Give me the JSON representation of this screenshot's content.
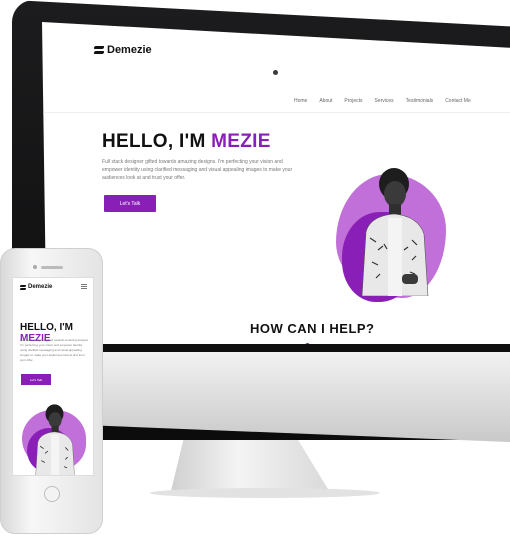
{
  "site": {
    "logo_text": "Demezie",
    "nav": [
      "Home",
      "About",
      "Projects",
      "Services",
      "Testimonials",
      "Contact Me"
    ],
    "hero_prefix": "HELLO, I'M ",
    "hero_name": "MEZIE",
    "hero_text": "Full stack designer gifted towards amazing designs. I'm perfecting your vision and empower identity using clarified messaging and visual appealing images to make your audiences look at and trust your offer.",
    "cta_label": "Let's Talk",
    "section_title": "HOW CAN I HELP?"
  },
  "colors": {
    "accent": "#8a1fb8",
    "accent_light": "#c070d8",
    "bezel": "#111111"
  }
}
